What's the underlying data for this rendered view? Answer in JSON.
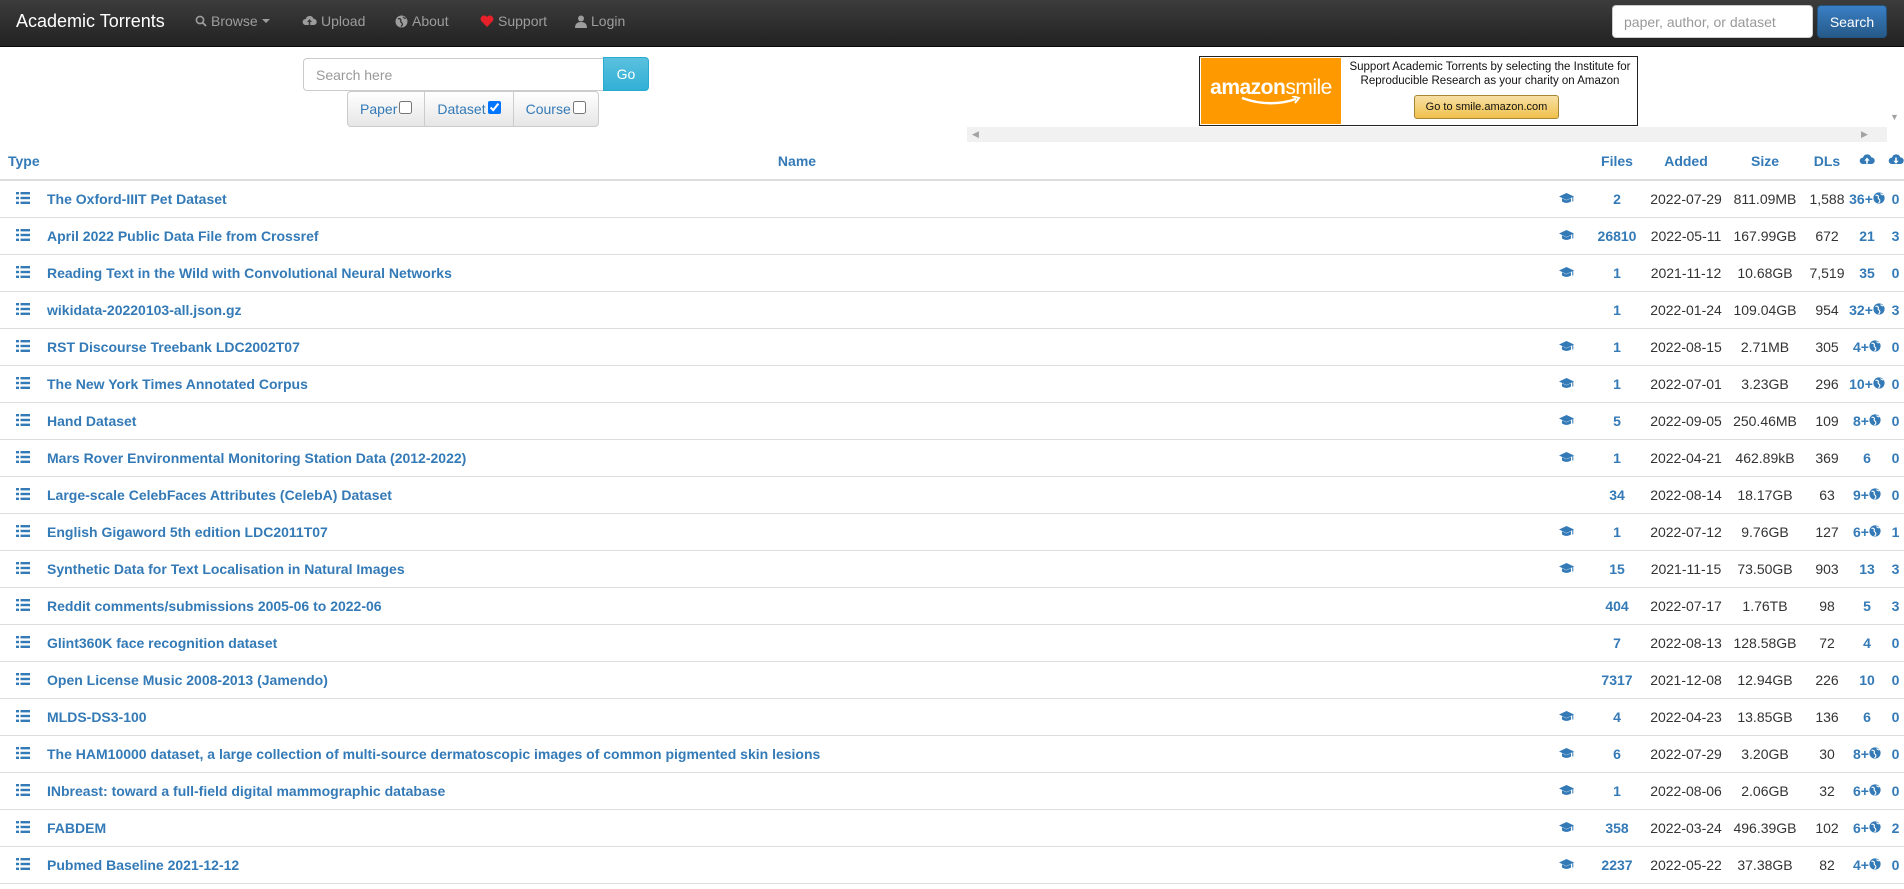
{
  "navbar": {
    "brand": "Academic Torrents",
    "browse": "Browse",
    "upload": "Upload",
    "about": "About",
    "support": "Support",
    "login": "Login",
    "search_placeholder": "paper, author, or dataset",
    "search_button": "Search"
  },
  "search": {
    "placeholder": "Search here",
    "go": "Go",
    "filters": [
      {
        "label": "Paper",
        "checked": false
      },
      {
        "label": "Dataset",
        "checked": true
      },
      {
        "label": "Course",
        "checked": false
      }
    ]
  },
  "ad": {
    "logo_word1": "amazon",
    "logo_word2": "smile",
    "copy": "Support Academic Torrents by selecting the Institute for Reproducible Research as your charity on Amazon",
    "button": "Go to smile.amazon.com"
  },
  "table": {
    "headers": {
      "type": "Type",
      "name": "Name",
      "files": "Files",
      "added": "Added",
      "size": "Size",
      "dls": "DLs",
      "seeders_icon": "cloud-upload-icon",
      "peers_icon": "cloud-download-icon"
    },
    "rows": [
      {
        "name": "The Oxford-IIIT Pet Dataset",
        "cap": true,
        "files": "2",
        "added": "2022-07-29",
        "size": "811.09MB",
        "dls": "1,588",
        "seeders": "36+",
        "webseed": true,
        "peers": "0"
      },
      {
        "name": "April 2022 Public Data File from Crossref",
        "cap": true,
        "files": "26810",
        "added": "2022-05-11",
        "size": "167.99GB",
        "dls": "672",
        "seeders": "21",
        "webseed": false,
        "peers": "3"
      },
      {
        "name": "Reading Text in the Wild with Convolutional Neural Networks",
        "cap": true,
        "files": "1",
        "added": "2021-11-12",
        "size": "10.68GB",
        "dls": "7,519",
        "seeders": "35",
        "webseed": false,
        "peers": "0"
      },
      {
        "name": "wikidata-20220103-all.json.gz",
        "cap": false,
        "files": "1",
        "added": "2022-01-24",
        "size": "109.04GB",
        "dls": "954",
        "seeders": "32+",
        "webseed": true,
        "peers": "3"
      },
      {
        "name": "RST Discourse Treebank LDC2002T07",
        "cap": true,
        "files": "1",
        "added": "2022-08-15",
        "size": "2.71MB",
        "dls": "305",
        "seeders": "4+",
        "webseed": true,
        "peers": "0"
      },
      {
        "name": "The New York Times Annotated Corpus",
        "cap": true,
        "files": "1",
        "added": "2022-07-01",
        "size": "3.23GB",
        "dls": "296",
        "seeders": "10+",
        "webseed": true,
        "peers": "0"
      },
      {
        "name": "Hand Dataset",
        "cap": true,
        "files": "5",
        "added": "2022-09-05",
        "size": "250.46MB",
        "dls": "109",
        "seeders": "8+",
        "webseed": true,
        "peers": "0"
      },
      {
        "name": "Mars Rover Environmental Monitoring Station Data (2012-2022)",
        "cap": true,
        "files": "1",
        "added": "2022-04-21",
        "size": "462.89kB",
        "dls": "369",
        "seeders": "6",
        "webseed": false,
        "peers": "0"
      },
      {
        "name": "Large-scale CelebFaces Attributes (CelebA) Dataset",
        "cap": false,
        "files": "34",
        "added": "2022-08-14",
        "size": "18.17GB",
        "dls": "63",
        "seeders": "9+",
        "webseed": true,
        "peers": "0"
      },
      {
        "name": "English Gigaword 5th edition LDC2011T07",
        "cap": true,
        "files": "1",
        "added": "2022-07-12",
        "size": "9.76GB",
        "dls": "127",
        "seeders": "6+",
        "webseed": true,
        "peers": "1"
      },
      {
        "name": "Synthetic Data for Text Localisation in Natural Images",
        "cap": true,
        "files": "15",
        "added": "2021-11-15",
        "size": "73.50GB",
        "dls": "903",
        "seeders": "13",
        "webseed": false,
        "peers": "3"
      },
      {
        "name": "Reddit comments/submissions 2005-06 to 2022-06",
        "cap": false,
        "files": "404",
        "added": "2022-07-17",
        "size": "1.76TB",
        "dls": "98",
        "seeders": "5",
        "webseed": false,
        "peers": "3"
      },
      {
        "name": "Glint360K face recognition dataset",
        "cap": false,
        "files": "7",
        "added": "2022-08-13",
        "size": "128.58GB",
        "dls": "72",
        "seeders": "4",
        "webseed": false,
        "peers": "0"
      },
      {
        "name": "Open License Music 2008-2013 (Jamendo)",
        "cap": false,
        "files": "7317",
        "added": "2021-12-08",
        "size": "12.94GB",
        "dls": "226",
        "seeders": "10",
        "webseed": false,
        "peers": "0"
      },
      {
        "name": "MLDS-DS3-100",
        "cap": true,
        "files": "4",
        "added": "2022-04-23",
        "size": "13.85GB",
        "dls": "136",
        "seeders": "6",
        "webseed": false,
        "peers": "0"
      },
      {
        "name": "The HAM10000 dataset, a large collection of multi-source dermatoscopic images of common pigmented skin lesions",
        "cap": true,
        "files": "6",
        "added": "2022-07-29",
        "size": "3.20GB",
        "dls": "30",
        "seeders": "8+",
        "webseed": true,
        "peers": "0"
      },
      {
        "name": "INbreast: toward a full-field digital mammographic database",
        "cap": true,
        "files": "1",
        "added": "2022-08-06",
        "size": "2.06GB",
        "dls": "32",
        "seeders": "6+",
        "webseed": true,
        "peers": "0"
      },
      {
        "name": "FABDEM",
        "cap": true,
        "files": "358",
        "added": "2022-03-24",
        "size": "496.39GB",
        "dls": "102",
        "seeders": "6+",
        "webseed": true,
        "peers": "2"
      },
      {
        "name": "Pubmed Baseline 2021-12-12",
        "cap": true,
        "files": "2237",
        "added": "2022-05-22",
        "size": "37.38GB",
        "dls": "82",
        "seeders": "4+",
        "webseed": true,
        "peers": "0"
      }
    ]
  },
  "colors": {
    "link": "#337ab7",
    "navbar": "#222222",
    "accent_heart": "#d9534f",
    "amazon_orange": "#ff9900"
  }
}
